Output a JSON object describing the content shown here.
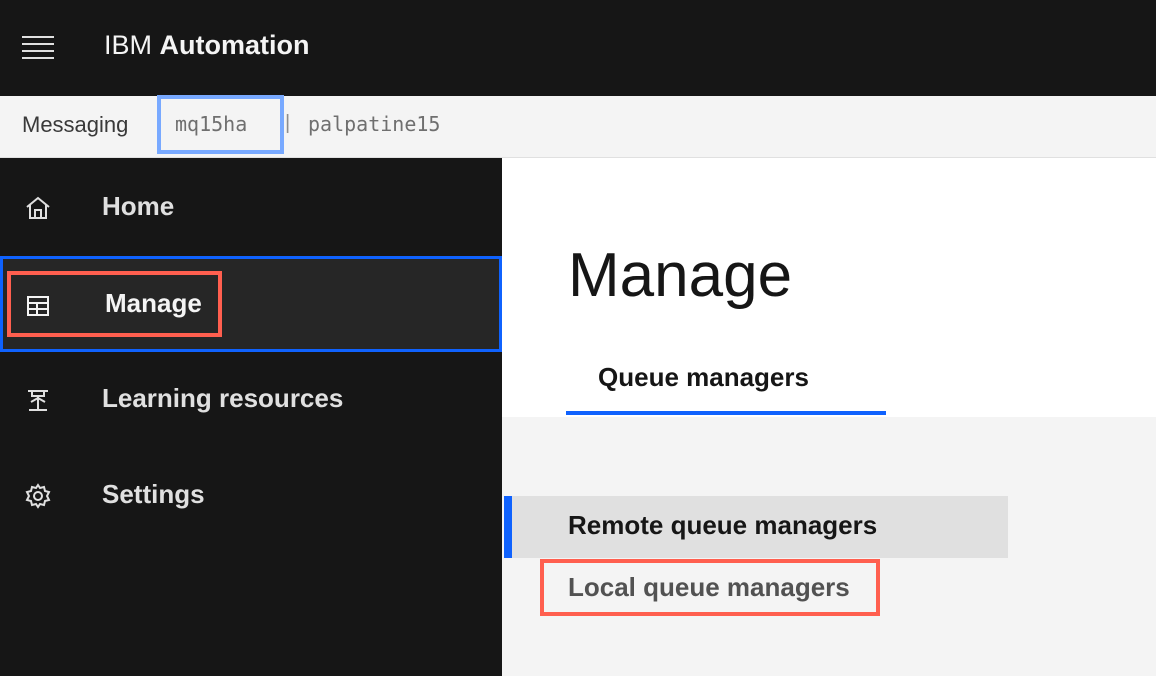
{
  "header": {
    "brand": "IBM",
    "product": "Automation",
    "menu_icon": "hamburger-menu-icon"
  },
  "context_bar": {
    "label": "Messaging",
    "instance": "mq15ha",
    "separator": "|",
    "cluster": "palpatine15"
  },
  "sidenav": {
    "items": [
      {
        "label": "Home",
        "icon": "home-icon"
      },
      {
        "label": "Manage",
        "icon": "table-icon",
        "active": true
      },
      {
        "label": "Learning resources",
        "icon": "learning-icon"
      },
      {
        "label": "Settings",
        "icon": "gear-icon"
      }
    ]
  },
  "main": {
    "title": "Manage",
    "tabs": [
      {
        "label": "Queue managers",
        "selected": true
      }
    ],
    "subnav": [
      {
        "label": "Remote queue managers",
        "selected": true
      },
      {
        "label": "Local queue managers"
      }
    ]
  },
  "colors": {
    "accent": "#0f62fe",
    "annotation_red": "#ff5f4f",
    "annotation_blue": "#78a9ff",
    "header_bg": "#161616"
  }
}
